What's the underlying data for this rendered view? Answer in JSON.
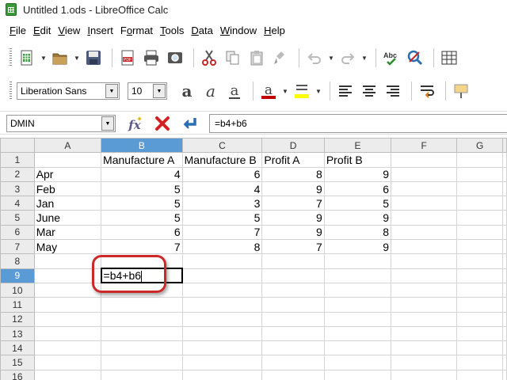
{
  "window": {
    "title": "Untitled 1.ods - LibreOffice Calc"
  },
  "menu": [
    {
      "key": "F",
      "rest": "ile"
    },
    {
      "key": "E",
      "rest": "dit"
    },
    {
      "key": "V",
      "rest": "iew"
    },
    {
      "key": "I",
      "rest": "nsert"
    },
    {
      "key": "",
      "pre": "F",
      "ukey": "o",
      "rest": "rmat"
    },
    {
      "key": "T",
      "rest": "ools"
    },
    {
      "key": "D",
      "rest": "ata"
    },
    {
      "key": "W",
      "rest": "indow"
    },
    {
      "key": "H",
      "rest": "elp"
    }
  ],
  "format_toolbar": {
    "font_name": "Liberation Sans",
    "font_size": "10"
  },
  "formula_bar": {
    "name_box": "DMIN",
    "formula": "=b4+b6"
  },
  "sheet": {
    "columns": [
      "A",
      "B",
      "C",
      "D",
      "E",
      "F",
      "G"
    ],
    "active_column": "B",
    "active_row": "9",
    "rows": [
      {
        "n": "1",
        "a": "",
        "b": "Manufacture A",
        "c": "Manufacture B",
        "d": "Profit A",
        "e": "Profit B"
      },
      {
        "n": "2",
        "a": "Apr",
        "b": "4",
        "c": "6",
        "d": "8",
        "e": "9"
      },
      {
        "n": "3",
        "a": "Feb",
        "b": "5",
        "c": "4",
        "d": "9",
        "e": "6"
      },
      {
        "n": "4",
        "a": "Jan",
        "b": "5",
        "c": "3",
        "d": "7",
        "e": "5"
      },
      {
        "n": "5",
        "a": "June",
        "b": "5",
        "c": "5",
        "d": "9",
        "e": "9"
      },
      {
        "n": "6",
        "a": "Mar",
        "b": "6",
        "c": "7",
        "d": "9",
        "e": "8"
      },
      {
        "n": "7",
        "a": "May",
        "b": "7",
        "c": "8",
        "d": "7",
        "e": "9"
      },
      {
        "n": "8",
        "a": "",
        "b": "",
        "c": "",
        "d": "",
        "e": ""
      },
      {
        "n": "9",
        "a": "",
        "b": "=b4+b6",
        "c": "",
        "d": "",
        "e": ""
      },
      {
        "n": "10",
        "a": "",
        "b": "",
        "c": "",
        "d": "",
        "e": ""
      },
      {
        "n": "11",
        "a": "",
        "b": "",
        "c": "",
        "d": "",
        "e": ""
      },
      {
        "n": "12",
        "a": "",
        "b": "",
        "c": "",
        "d": "",
        "e": ""
      },
      {
        "n": "13",
        "a": "",
        "b": "",
        "c": "",
        "d": "",
        "e": ""
      },
      {
        "n": "14",
        "a": "",
        "b": "",
        "c": "",
        "d": "",
        "e": ""
      },
      {
        "n": "15",
        "a": "",
        "b": "",
        "c": "",
        "d": "",
        "e": ""
      },
      {
        "n": "16",
        "a": "",
        "b": "",
        "c": "",
        "d": "",
        "e": ""
      }
    ]
  },
  "colors": {
    "selection": "#5b9bd5",
    "highlight_ring": "#cc2828",
    "font_color": "#c00000",
    "highlight_color": "#ffff00"
  },
  "icons": [
    "new-doc-icon",
    "open-icon",
    "save-icon",
    "export-pdf-icon",
    "print-icon",
    "print-preview-icon",
    "cut-icon",
    "copy-icon",
    "paste-icon",
    "clone-format-icon",
    "undo-icon",
    "redo-icon",
    "spellcheck-icon",
    "autospell-icon",
    "bold-icon",
    "italic-icon",
    "underline-icon",
    "font-color-icon",
    "highlight-icon",
    "align-left-icon",
    "align-center-icon",
    "align-right-icon",
    "wrap-text-icon",
    "function-wizard-icon",
    "cancel-icon",
    "accept-icon"
  ]
}
